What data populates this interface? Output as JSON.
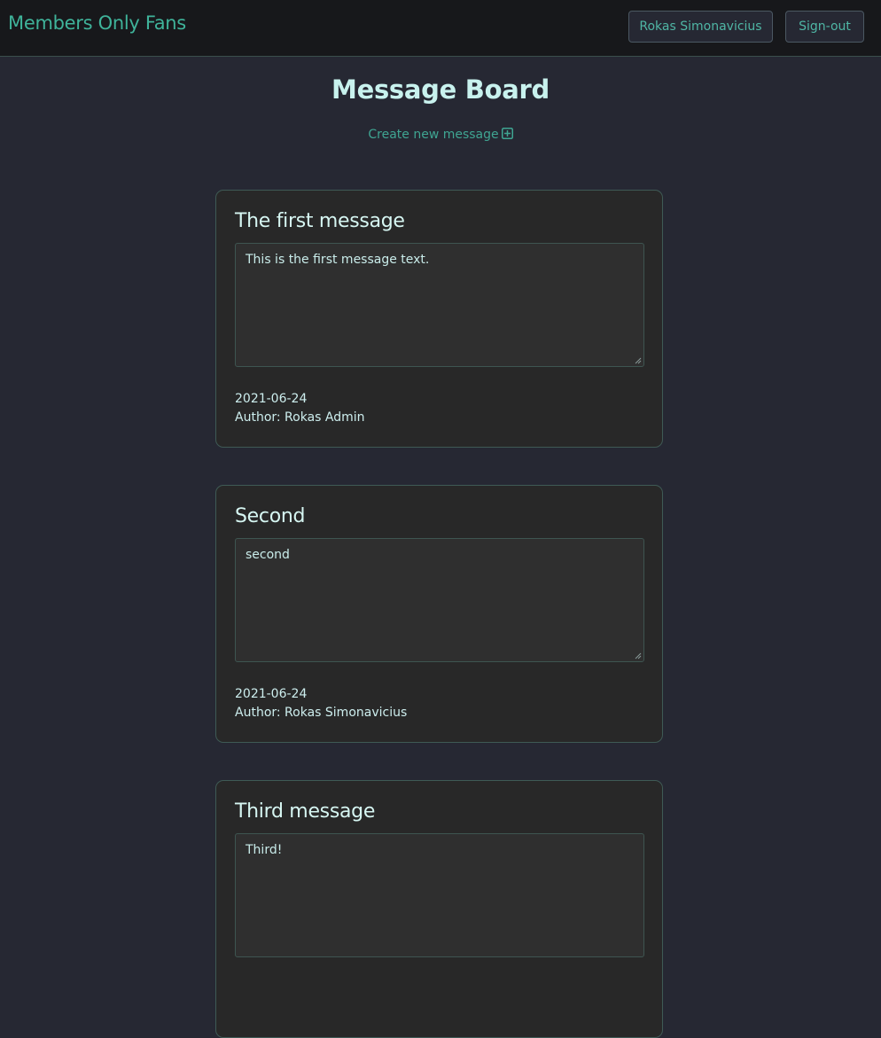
{
  "navbar": {
    "brand": "Members Only Fans",
    "user_label": "Rokas Simonavicius",
    "signout_label": "Sign-out"
  },
  "page": {
    "title": "Message Board",
    "create_label": "Create new message"
  },
  "messages": [
    {
      "title": "The first message",
      "body": "This is the first message text.",
      "date": "2021-06-24",
      "author": "Author: Rokas Admin"
    },
    {
      "title": "Second",
      "body": "second",
      "date": "2021-06-24",
      "author": "Author: Rokas Simonavicius"
    },
    {
      "title": "Third message",
      "body": "Third!",
      "date": "",
      "author": ""
    }
  ],
  "colors": {
    "page_background": "#262833",
    "navbar_background": "#17181b",
    "accent": "#3fb39a",
    "card_background": "#282828",
    "card_border": "#3f5a55",
    "heading_text": "#c8f2ee"
  }
}
